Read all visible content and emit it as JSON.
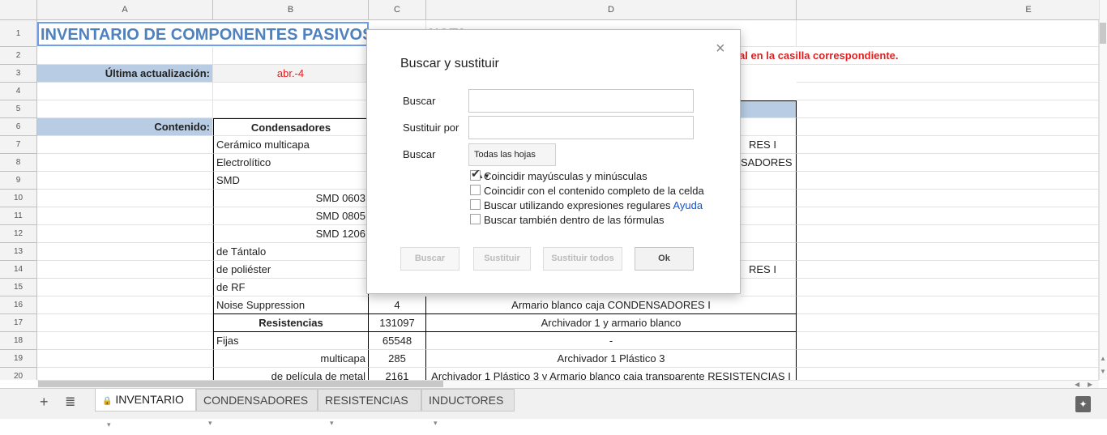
{
  "columns": [
    "A",
    "B",
    "C",
    "D",
    "E"
  ],
  "rows": [
    "1",
    "2",
    "3",
    "4",
    "5",
    "6",
    "7",
    "8",
    "9",
    "10",
    "11",
    "12",
    "13",
    "14",
    "15",
    "16",
    "17",
    "18",
    "19",
    "20"
  ],
  "sheet": {
    "title": "INVENTARIO DE COMPONENTES PASIVOS",
    "nota": "NOTA",
    "note_text": "al en la casilla correspondiente.",
    "last_update_label": "Última actualización:",
    "last_update_value": "abr.-4",
    "content_label": "Contenido:",
    "b6": "Condensadores",
    "b7": "Cerámico multicapa",
    "b8": "Electrolítico",
    "b9": "SMD",
    "b10": "SMD 0603",
    "b11": "SMD 0805",
    "b12": "SMD 1206",
    "b13": "de Tántalo",
    "b14": "de poliéster",
    "b15": "de RF",
    "b16": "Noise Suppression",
    "b17": "Resistencias",
    "b18": "Fijas",
    "b19": "multicapa",
    "b20": "de película de metal",
    "c16": "4",
    "c17": "131097",
    "c18": "65548",
    "c19": "285",
    "c20": "2161",
    "d7": "RES I",
    "d8": "SADORES I",
    "d14": "RES I",
    "d16": "Armario blanco caja CONDENSADORES I",
    "d17": "Archivador 1 y armario blanco",
    "d18": "-",
    "d19": "Archivador 1 Plástico 3",
    "d20": "Archivador 1 Plástico 3 y Armario blanco caja transparente RESISTENCIAS I"
  },
  "dialog": {
    "title": "Buscar y sustituir",
    "close": "×",
    "find_label": "Buscar",
    "find_value": "",
    "replace_label": "Sustituir por",
    "replace_value": "",
    "search_label": "Buscar",
    "scope": "Todas las hojas",
    "options": [
      {
        "label": "Coincidir mayúsculas y minúsculas",
        "checked": true
      },
      {
        "label": "Coincidir con el contenido completo de la celda",
        "checked": false
      },
      {
        "label": "Buscar utilizando expresiones regulares",
        "checked": false
      },
      {
        "label": "Buscar también dentro de las fórmulas",
        "checked": false
      }
    ],
    "help_link": "Ayuda",
    "buttons": {
      "find": "Buscar",
      "replace": "Sustituir",
      "replace_all": "Sustituir todos",
      "ok": "Ok"
    }
  },
  "tabs": {
    "add": "+",
    "list": "≣",
    "items": [
      "INVENTARIO",
      "CONDENSADORES",
      "RESISTENCIAS",
      "INDUCTORES"
    ],
    "lock": "🔒",
    "caret": "▾"
  },
  "colors": {
    "header_blue": "#b8cce4",
    "title_blue": "#4f81bd",
    "note_red": "#e02020",
    "link": "#1155cc"
  }
}
